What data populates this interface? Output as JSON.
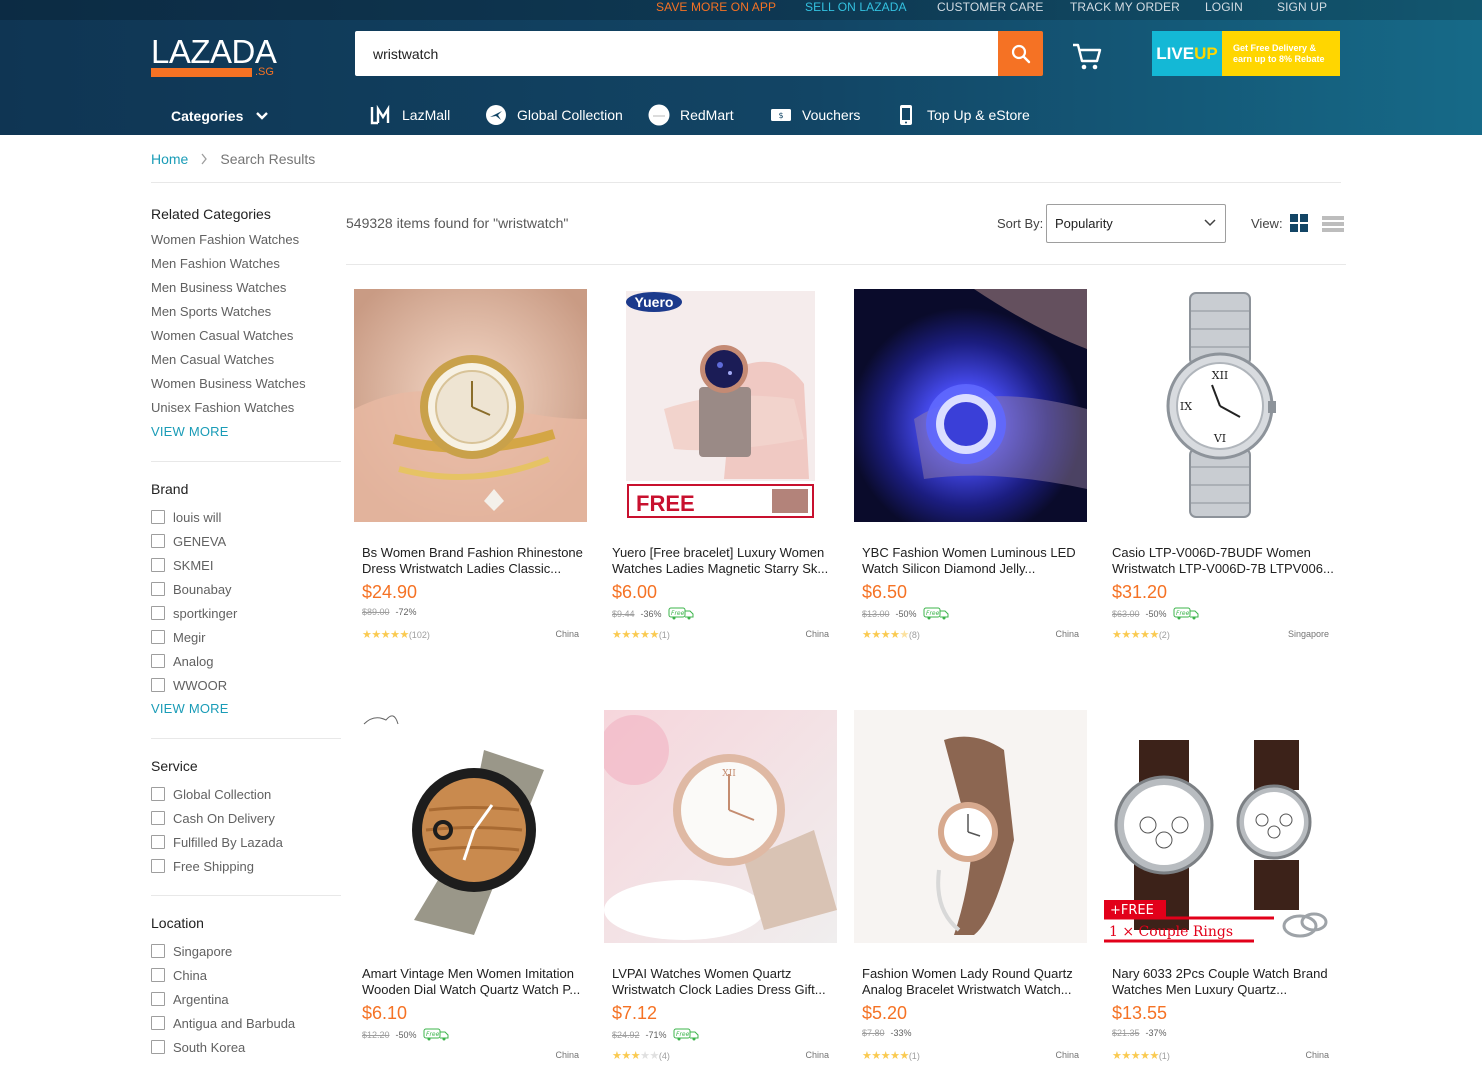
{
  "topbar": {
    "links": [
      "SAVE MORE ON APP",
      "SELL ON LAZADA",
      "CUSTOMER CARE",
      "TRACK MY ORDER",
      "LOGIN",
      "SIGN UP"
    ]
  },
  "logo": {
    "text": "LAZADA",
    "region": ".SG"
  },
  "search": {
    "value": "wristwatch"
  },
  "liveup": {
    "logo_a": "LIVE",
    "logo_b": "UP",
    "line1": "Get Free Delivery &",
    "line2": "earn up to 8% Rebate"
  },
  "nav": {
    "categories": "Categories",
    "items": [
      "LazMall",
      "Global Collection",
      "RedMart",
      "Vouchers",
      "Top Up & eStore"
    ]
  },
  "breadcrumb": {
    "home": "Home",
    "current": "Search Results"
  },
  "sidebar": {
    "related": {
      "title": "Related Categories",
      "items": [
        "Women Fashion Watches",
        "Men Fashion Watches",
        "Men Business Watches",
        "Men Sports Watches",
        "Women Casual Watches",
        "Men Casual Watches",
        "Women Business Watches",
        "Unisex Fashion Watches"
      ],
      "view_more": "VIEW MORE"
    },
    "brand": {
      "title": "Brand",
      "items": [
        "louis will",
        "GENEVA",
        "SKMEI",
        "Bounabay",
        "sportkinger",
        "Megir",
        "Analog",
        "WWOOR"
      ],
      "view_more": "VIEW MORE"
    },
    "service": {
      "title": "Service",
      "items": [
        "Global Collection",
        "Cash On Delivery",
        "Fulfilled By Lazada",
        "Free Shipping"
      ]
    },
    "location": {
      "title": "Location",
      "items": [
        "Singapore",
        "China",
        "Argentina",
        "Antigua and Barbuda",
        "South Korea"
      ]
    }
  },
  "results": {
    "count_text": "549328 items found for \"wristwatch\"",
    "sort_label": "Sort By:",
    "sort_value": "Popularity",
    "view_label": "View:"
  },
  "colors": {
    "accent": "#f57224",
    "link": "#1a9cb7",
    "star": "#faca51"
  },
  "products": [
    {
      "title": "Bs Women Brand Fashion Rhinestone Dress Wristwatch Ladies Classic...",
      "price": "$24.90",
      "old_price": "$89.00",
      "discount": "-72%",
      "free": false,
      "rating": 5,
      "reviews": "(102)",
      "location": "China"
    },
    {
      "title": "Yuero [Free bracelet] Luxury Women Watches Ladies Magnetic Starry Sk...",
      "price": "$6.00",
      "old_price": "$9.44",
      "discount": "-36%",
      "free": true,
      "rating": 5,
      "reviews": "(1)",
      "location": "China",
      "img_text_brand": "Yuero",
      "img_text_banner": "FREE"
    },
    {
      "title": "YBC Fashion Women Luminous LED Watch Silicon Diamond Jelly...",
      "price": "$6.50",
      "old_price": "$13.00",
      "discount": "-50%",
      "free": true,
      "rating": 4.5,
      "reviews": "(8)",
      "location": "China"
    },
    {
      "title": "Casio LTP-V006D-7BUDF Women Wristwatch LTP-V006D-7B LTPV006...",
      "price": "$31.20",
      "old_price": "$63.00",
      "discount": "-50%",
      "free": true,
      "rating": 5,
      "reviews": "(2)",
      "location": "Singapore"
    },
    {
      "title": "Amart Vintage Men Women Imitation Wooden Dial Watch Quartz Watch P...",
      "price": "$6.10",
      "old_price": "$12.20",
      "discount": "-50%",
      "free": true,
      "rating": 0,
      "reviews": "",
      "location": "China"
    },
    {
      "title": "LVPAI Watches Women Quartz Wristwatch Clock Ladies Dress Gift...",
      "price": "$7.12",
      "old_price": "$24.92",
      "discount": "-71%",
      "free": true,
      "rating": 3,
      "reviews": "(4)",
      "location": "China"
    },
    {
      "title": "Fashion Women Lady Round Quartz Analog Bracelet Wristwatch Watch...",
      "price": "$5.20",
      "old_price": "$7.80",
      "discount": "-33%",
      "free": false,
      "rating": 5,
      "reviews": "(1)",
      "location": "China"
    },
    {
      "title": "Nary 6033 2Pcs Couple Watch Brand Watches Men Luxury Quartz...",
      "price": "$13.55",
      "old_price": "$21.35",
      "discount": "-37%",
      "free": false,
      "rating": 5,
      "reviews": "(1)",
      "location": "China",
      "img_text_free": "+FREE",
      "img_text_rings": "1 × Couple Rings"
    }
  ]
}
